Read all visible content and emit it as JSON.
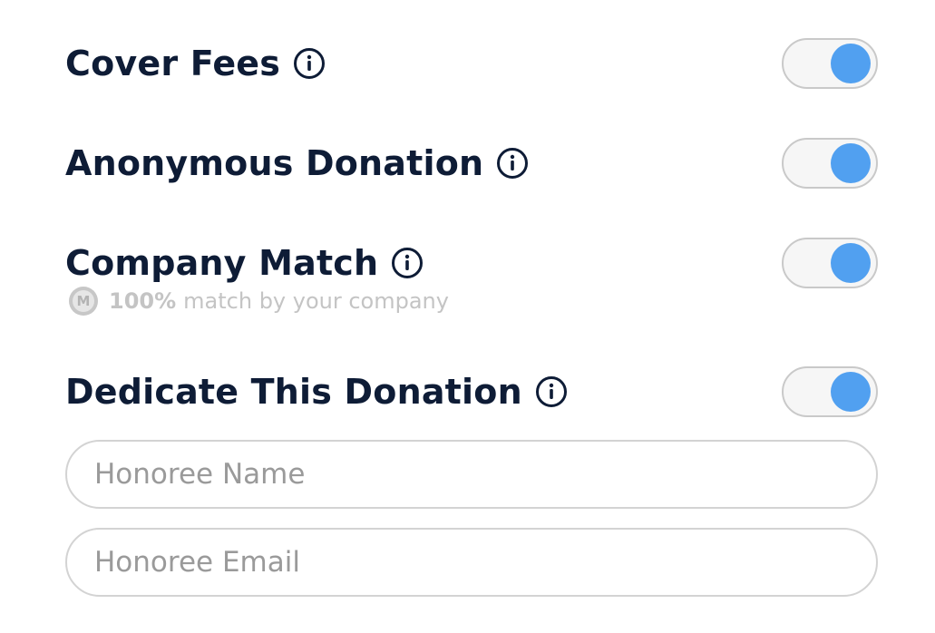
{
  "options": [
    {
      "label": "Cover Fees",
      "info_icon": "info-circle-icon",
      "enabled": true
    },
    {
      "label": "Anonymous Donation",
      "info_icon": "info-circle-icon",
      "enabled": true
    },
    {
      "label": "Company Match",
      "info_icon": "info-circle-icon",
      "enabled": true
    },
    {
      "label": "Dedicate This Donation",
      "info_icon": "info-circle-icon",
      "enabled": true
    }
  ],
  "company_match": {
    "badge_letter": "M",
    "percent": "100%",
    "text": "match by your company"
  },
  "honoree": {
    "name_placeholder": "Honoree Name",
    "email_placeholder": "Honoree Email"
  },
  "colors": {
    "label": "#0e1c36",
    "toggle_knob": "#51a0f0",
    "toggle_track": "#f6f6f6",
    "muted": "#c4c4c4"
  }
}
